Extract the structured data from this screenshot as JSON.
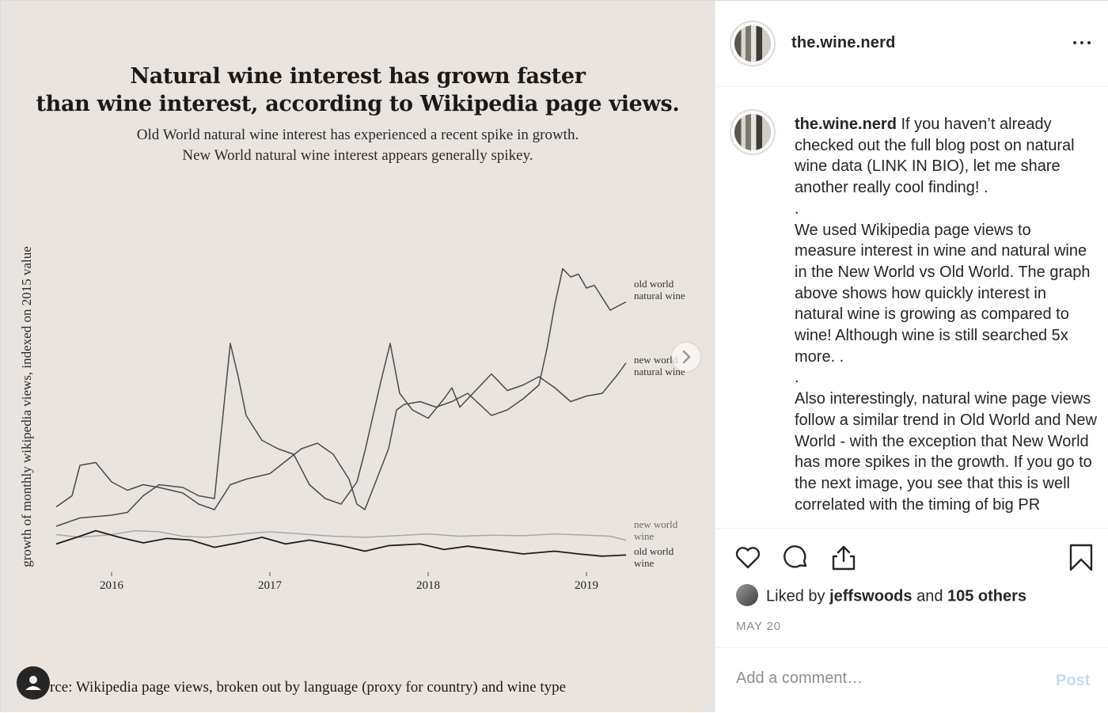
{
  "post": {
    "username": "the.wine.nerd",
    "more_icon": "more-horizontal-icon"
  },
  "media": {
    "chart_data": {
      "type": "line",
      "title_line1": "Natural wine interest has grown faster",
      "title_line2": "than wine interest, according to Wikipedia page views.",
      "subtitle_line1": "Old World natural wine interest has experienced a recent spike in growth.",
      "subtitle_line2": "New World natural wine interest appears generally spikey.",
      "ylabel": "growth of monthly wikipedia views, indexed on 2015 value",
      "xticks": [
        "2016",
        "2017",
        "2018",
        "2019"
      ],
      "xlim": [
        2015.65,
        2019.25
      ],
      "grid": false,
      "legend_placement": "direct-labels-right",
      "series": [
        {
          "name": "old world natural wine",
          "label_line1": "old world",
          "label_line2": "natural wine",
          "color": "#4a4a4a",
          "points": [
            [
              2015.65,
              1.15
            ],
            [
              2015.75,
              1.35
            ],
            [
              2015.8,
              1.9
            ],
            [
              2015.9,
              1.95
            ],
            [
              2016.0,
              1.6
            ],
            [
              2016.1,
              1.45
            ],
            [
              2016.2,
              1.55
            ],
            [
              2016.3,
              1.5
            ],
            [
              2016.45,
              1.4
            ],
            [
              2016.55,
              1.2
            ],
            [
              2016.65,
              1.1
            ],
            [
              2016.75,
              1.55
            ],
            [
              2016.85,
              1.65
            ],
            [
              2017.0,
              1.75
            ],
            [
              2017.2,
              2.2
            ],
            [
              2017.3,
              2.3
            ],
            [
              2017.4,
              2.1
            ],
            [
              2017.5,
              1.65
            ],
            [
              2017.55,
              1.2
            ],
            [
              2017.6,
              1.1
            ],
            [
              2017.75,
              2.2
            ],
            [
              2017.8,
              2.9
            ],
            [
              2017.85,
              3.0
            ],
            [
              2017.95,
              3.05
            ],
            [
              2018.05,
              2.95
            ],
            [
              2018.15,
              3.05
            ],
            [
              2018.25,
              3.2
            ],
            [
              2018.4,
              2.8
            ],
            [
              2018.5,
              2.9
            ],
            [
              2018.6,
              3.1
            ],
            [
              2018.7,
              3.35
            ],
            [
              2018.75,
              4.0
            ],
            [
              2018.8,
              4.8
            ],
            [
              2018.85,
              5.45
            ],
            [
              2018.9,
              5.3
            ],
            [
              2018.95,
              5.35
            ],
            [
              2019.0,
              5.1
            ],
            [
              2019.05,
              5.15
            ],
            [
              2019.15,
              4.7
            ],
            [
              2019.25,
              4.85
            ]
          ]
        },
        {
          "name": "new world natural wine",
          "label_line1": "new world",
          "label_line2": "natural wine",
          "color": "#4a4a4a",
          "points": [
            [
              2015.65,
              0.8
            ],
            [
              2015.8,
              0.95
            ],
            [
              2016.0,
              1.0
            ],
            [
              2016.1,
              1.05
            ],
            [
              2016.2,
              1.35
            ],
            [
              2016.3,
              1.55
            ],
            [
              2016.45,
              1.5
            ],
            [
              2016.55,
              1.35
            ],
            [
              2016.65,
              1.3
            ],
            [
              2016.75,
              4.1
            ],
            [
              2016.8,
              3.5
            ],
            [
              2016.85,
              2.8
            ],
            [
              2016.95,
              2.35
            ],
            [
              2017.05,
              2.2
            ],
            [
              2017.15,
              2.1
            ],
            [
              2017.25,
              1.55
            ],
            [
              2017.35,
              1.3
            ],
            [
              2017.45,
              1.2
            ],
            [
              2017.55,
              1.6
            ],
            [
              2017.6,
              2.15
            ],
            [
              2017.7,
              3.4
            ],
            [
              2017.76,
              4.1
            ],
            [
              2017.82,
              3.2
            ],
            [
              2017.9,
              2.9
            ],
            [
              2018.0,
              2.75
            ],
            [
              2018.1,
              3.1
            ],
            [
              2018.15,
              3.3
            ],
            [
              2018.2,
              2.95
            ],
            [
              2018.3,
              3.25
            ],
            [
              2018.4,
              3.55
            ],
            [
              2018.5,
              3.25
            ],
            [
              2018.6,
              3.35
            ],
            [
              2018.7,
              3.5
            ],
            [
              2018.8,
              3.3
            ],
            [
              2018.9,
              3.05
            ],
            [
              2019.0,
              3.15
            ],
            [
              2019.1,
              3.2
            ],
            [
              2019.2,
              3.55
            ],
            [
              2019.25,
              3.75
            ]
          ]
        },
        {
          "name": "new world wine",
          "label_line1": "new world",
          "label_line2": "wine",
          "color": "#a8a8a8",
          "points": [
            [
              2015.65,
              0.65
            ],
            [
              2015.8,
              0.6
            ],
            [
              2016.0,
              0.65
            ],
            [
              2016.15,
              0.72
            ],
            [
              2016.3,
              0.7
            ],
            [
              2016.45,
              0.62
            ],
            [
              2016.6,
              0.6
            ],
            [
              2016.75,
              0.64
            ],
            [
              2016.9,
              0.68
            ],
            [
              2017.0,
              0.7
            ],
            [
              2017.2,
              0.66
            ],
            [
              2017.4,
              0.62
            ],
            [
              2017.6,
              0.6
            ],
            [
              2017.8,
              0.63
            ],
            [
              2018.0,
              0.66
            ],
            [
              2018.2,
              0.62
            ],
            [
              2018.4,
              0.64
            ],
            [
              2018.6,
              0.63
            ],
            [
              2018.8,
              0.66
            ],
            [
              2019.0,
              0.64
            ],
            [
              2019.15,
              0.62
            ],
            [
              2019.25,
              0.55
            ]
          ]
        },
        {
          "name": "old world wine",
          "label_line1": "old world",
          "label_line2": "wine",
          "color": "#1c1c1c",
          "points": [
            [
              2015.65,
              0.48
            ],
            [
              2015.8,
              0.62
            ],
            [
              2015.9,
              0.72
            ],
            [
              2016.05,
              0.6
            ],
            [
              2016.2,
              0.5
            ],
            [
              2016.35,
              0.58
            ],
            [
              2016.5,
              0.55
            ],
            [
              2016.65,
              0.42
            ],
            [
              2016.8,
              0.5
            ],
            [
              2016.95,
              0.6
            ],
            [
              2017.1,
              0.48
            ],
            [
              2017.25,
              0.55
            ],
            [
              2017.45,
              0.45
            ],
            [
              2017.6,
              0.35
            ],
            [
              2017.75,
              0.45
            ],
            [
              2017.95,
              0.48
            ],
            [
              2018.1,
              0.38
            ],
            [
              2018.25,
              0.44
            ],
            [
              2018.45,
              0.36
            ],
            [
              2018.6,
              0.3
            ],
            [
              2018.8,
              0.35
            ],
            [
              2018.95,
              0.3
            ],
            [
              2019.1,
              0.26
            ],
            [
              2019.25,
              0.28
            ]
          ]
        }
      ]
    },
    "source_text": "rce: Wikipedia page views, broken out by language (proxy for country) and wine type",
    "next_icon": "chevron-right-icon",
    "account_icon": "user-icon"
  },
  "caption": {
    "username": "the.wine.nerd",
    "text": " If you haven’t already checked out the full blog post on natural wine data (LINK IN BIO), let me share another really cool finding! .\n.\nWe used Wikipedia page views to measure interest in wine and natural wine in the New World vs Old World. The graph above shows how quickly interest in natural wine is growing as compared to wine! Although wine is still searched 5x more. .\n.\nAlso interestingly, natural wine page views follow a similar trend in Old World and New World - with the exception that New World has more spikes in the growth. If you go to the next image, you see that this is well correlated with the timing of big PR"
  },
  "actions": {
    "like_icon": "heart-icon",
    "comment_icon": "comment-icon",
    "share_icon": "share-icon",
    "save_icon": "bookmark-icon"
  },
  "likes": {
    "prefix": "Liked by ",
    "user": "jeffswoods",
    "middle": " and ",
    "others": "105 others"
  },
  "date": "MAY 20",
  "comment": {
    "placeholder": "Add a comment…",
    "post_label": "Post"
  }
}
